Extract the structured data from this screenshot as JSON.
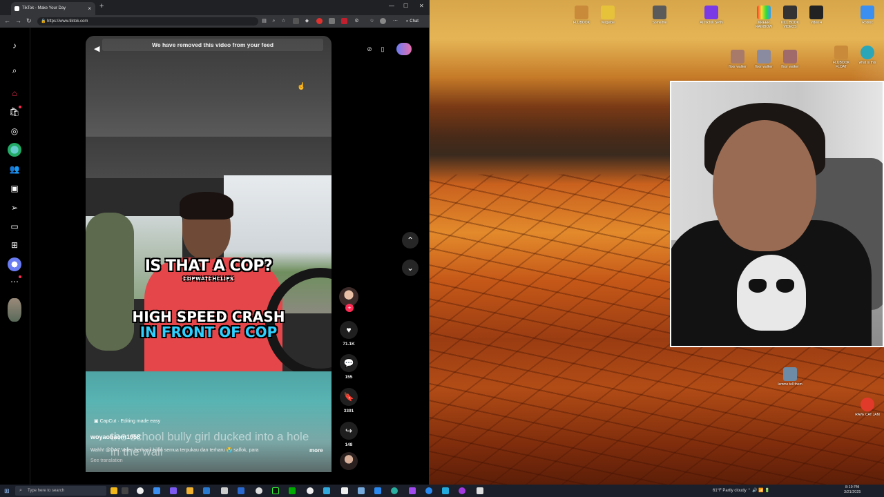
{
  "browser": {
    "tab_title": "TikTok - Make Your Day",
    "url": "https://www.tiktok.com",
    "chat_label": "Chat"
  },
  "feed": {
    "removed_notice": "We have removed this video from your feed"
  },
  "video": {
    "caption_top": "IS THAT A COP?",
    "caption_brand": "COPWATCHCLIPS",
    "caption_line1": "HIGH SPEED CRASH",
    "caption_line2": "IN FRONT OF COP",
    "capcut_tag": "CapCut · Editing made easy",
    "author": "woyaobaom1058",
    "overlay_text": "the school bully girl ducked into a hole in the wall",
    "description": "Wahh! @DA7.Valen berhasil bikin semua terpukau dan terharu 😭 salfok, para",
    "more_label": "more",
    "translate_label": "See translation",
    "likes": "71.1K",
    "comments": "155",
    "saves": "3391",
    "shares": "148"
  },
  "desktop": {
    "icons": [
      "FLUBOOK",
      "Vergeibe",
      "Some file",
      "AI TikTok SPIN",
      "KREEP RAINBOW",
      "KILL BOOK VIDEOS",
      "video 4",
      "Roblox",
      "floor walker",
      "floor walker",
      "floor walker",
      "FLUBOOK FLOAT",
      "what is this",
      "lemme tell them",
      "RAVE CAT JAM"
    ]
  },
  "taskbar": {
    "search_placeholder": "Type here to search",
    "weather": "61°F  Partly cloudy",
    "time": "8:19 PM",
    "date": "3/21/2025"
  },
  "colors": {
    "tiktok_accent": "#fe2c55",
    "caption_cyan": "#2fd0ff"
  }
}
